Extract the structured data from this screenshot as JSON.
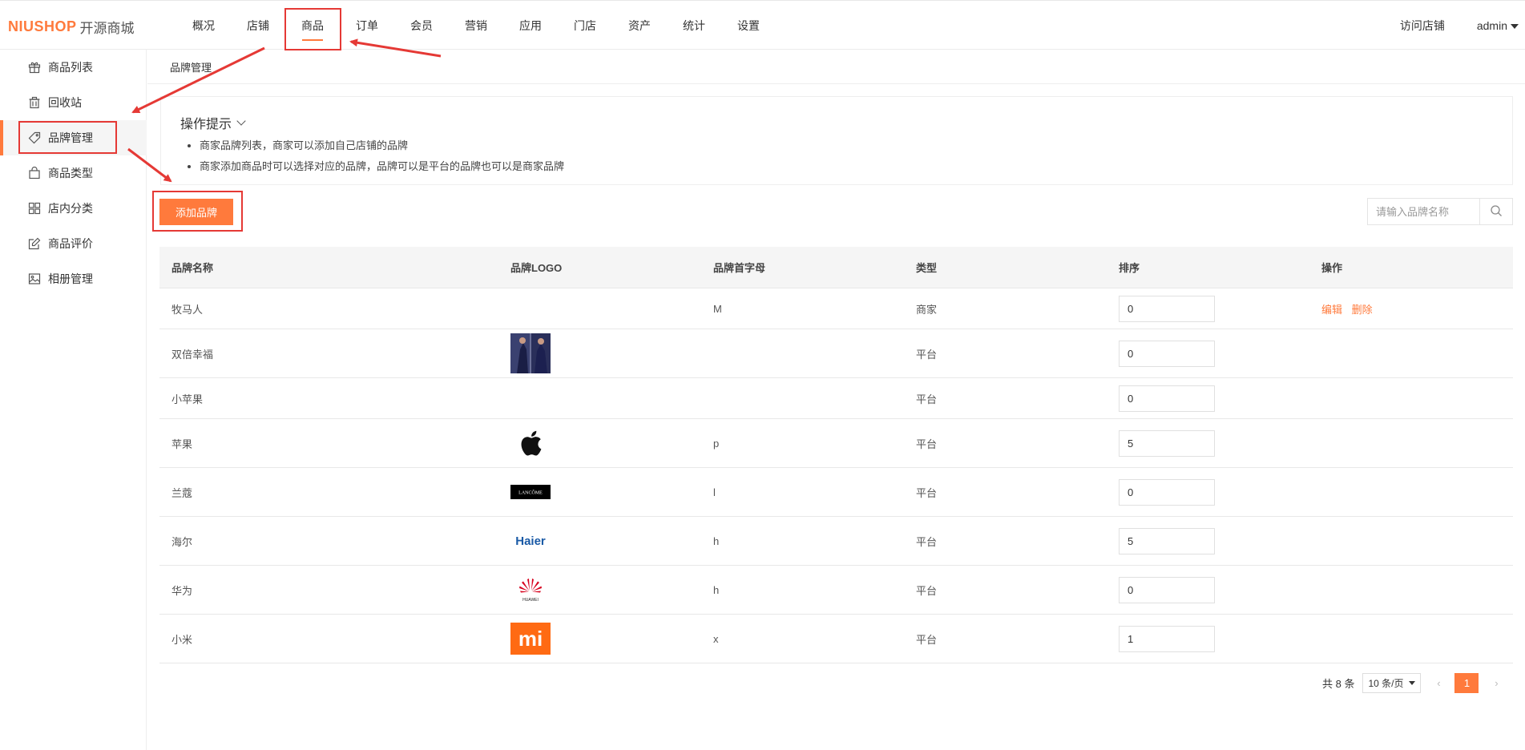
{
  "header": {
    "logo_en": "NIUSHOP",
    "logo_cn": "开源商城",
    "nav": [
      "概况",
      "店铺",
      "商品",
      "订单",
      "会员",
      "营销",
      "应用",
      "门店",
      "资产",
      "统计",
      "设置"
    ],
    "active_nav": "商品",
    "visit_store": "访问店铺",
    "user": "admin"
  },
  "sidebar": {
    "items": [
      {
        "label": "商品列表",
        "icon": "gift-icon"
      },
      {
        "label": "回收站",
        "icon": "trash-icon"
      },
      {
        "label": "品牌管理",
        "icon": "tag-icon"
      },
      {
        "label": "商品类型",
        "icon": "bag-icon"
      },
      {
        "label": "店内分类",
        "icon": "grid-icon"
      },
      {
        "label": "商品评价",
        "icon": "edit-icon"
      },
      {
        "label": "相册管理",
        "icon": "image-icon"
      }
    ],
    "active": "品牌管理"
  },
  "breadcrumb": "品牌管理",
  "tips": {
    "title": "操作提示",
    "items": [
      "商家品牌列表，商家可以添加自己店铺的品牌",
      "商家添加商品时可以选择对应的品牌，品牌可以是平台的品牌也可以是商家品牌"
    ]
  },
  "add_button": "添加品牌",
  "search": {
    "placeholder": "请输入品牌名称"
  },
  "table": {
    "headers": [
      "品牌名称",
      "品牌LOGO",
      "品牌首字母",
      "类型",
      "排序",
      "操作"
    ],
    "rows": [
      {
        "name": "牧马人",
        "logo": "",
        "letter": "M",
        "type": "商家",
        "sort": "0",
        "ops": [
          "编辑",
          "删除"
        ]
      },
      {
        "name": "双倍幸福",
        "logo": "photo",
        "letter": "",
        "type": "平台",
        "sort": "0",
        "ops": []
      },
      {
        "name": "小苹果",
        "logo": "",
        "letter": "",
        "type": "平台",
        "sort": "0",
        "ops": []
      },
      {
        "name": "苹果",
        "logo": "apple",
        "letter": "p",
        "type": "平台",
        "sort": "5",
        "ops": []
      },
      {
        "name": "兰蔻",
        "logo": "lancome",
        "letter": "l",
        "type": "平台",
        "sort": "0",
        "ops": []
      },
      {
        "name": "海尔",
        "logo": "haier",
        "letter": "h",
        "type": "平台",
        "sort": "5",
        "ops": []
      },
      {
        "name": "华为",
        "logo": "huawei",
        "letter": "h",
        "type": "平台",
        "sort": "0",
        "ops": []
      },
      {
        "name": "小米",
        "logo": "mi",
        "letter": "x",
        "type": "平台",
        "sort": "1",
        "ops": []
      }
    ]
  },
  "logo_text": {
    "lancome": "LANCÔME",
    "haier": "Haier",
    "huawei": "HUAWEI",
    "mi": "mi"
  },
  "pagination": {
    "total": "共 8 条",
    "page_size": "10 条/页",
    "current": "1",
    "prev": "‹",
    "next": "›"
  },
  "colors": {
    "accent": "#ff7a3c",
    "annotation": "#e53935"
  }
}
